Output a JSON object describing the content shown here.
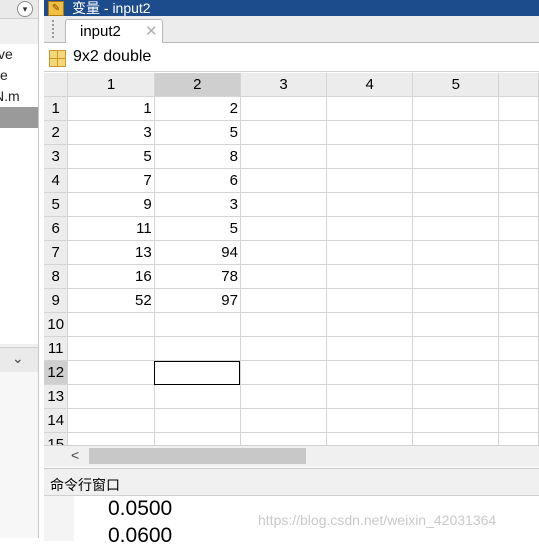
{
  "left_panel": {
    "dropdown_glyph": "▾",
    "files": [
      "ve",
      "e",
      "N.m",
      ""
    ],
    "selected_index": 3,
    "chevron": "⌄"
  },
  "editor": {
    "title": "变量 - input2",
    "tab_label": "input2",
    "tab_close": "✕",
    "var_size": "9x2 double",
    "columns": [
      "1",
      "2",
      "3",
      "4",
      "5",
      ""
    ],
    "rows": [
      {
        "n": "1",
        "c1": "1",
        "c2": "2"
      },
      {
        "n": "2",
        "c1": "3",
        "c2": "5"
      },
      {
        "n": "3",
        "c1": "5",
        "c2": "8"
      },
      {
        "n": "4",
        "c1": "7",
        "c2": "6"
      },
      {
        "n": "5",
        "c1": "9",
        "c2": "3"
      },
      {
        "n": "6",
        "c1": "11",
        "c2": "5"
      },
      {
        "n": "7",
        "c1": "13",
        "c2": "94"
      },
      {
        "n": "8",
        "c1": "16",
        "c2": "78"
      },
      {
        "n": "9",
        "c1": "52",
        "c2": "97"
      },
      {
        "n": "10",
        "c1": "",
        "c2": ""
      },
      {
        "n": "11",
        "c1": "",
        "c2": ""
      },
      {
        "n": "12",
        "c1": "",
        "c2": ""
      },
      {
        "n": "13",
        "c1": "",
        "c2": ""
      },
      {
        "n": "14",
        "c1": "",
        "c2": ""
      },
      {
        "n": "15",
        "c1": "",
        "c2": ""
      }
    ],
    "selected_row": "12",
    "selected_col": "2",
    "scroll_left": "<"
  },
  "command_window": {
    "title": "命令行窗口",
    "lines": [
      "0.0500",
      "0.0600"
    ]
  },
  "watermark": "https://blog.csdn.net/weixin_42031364"
}
